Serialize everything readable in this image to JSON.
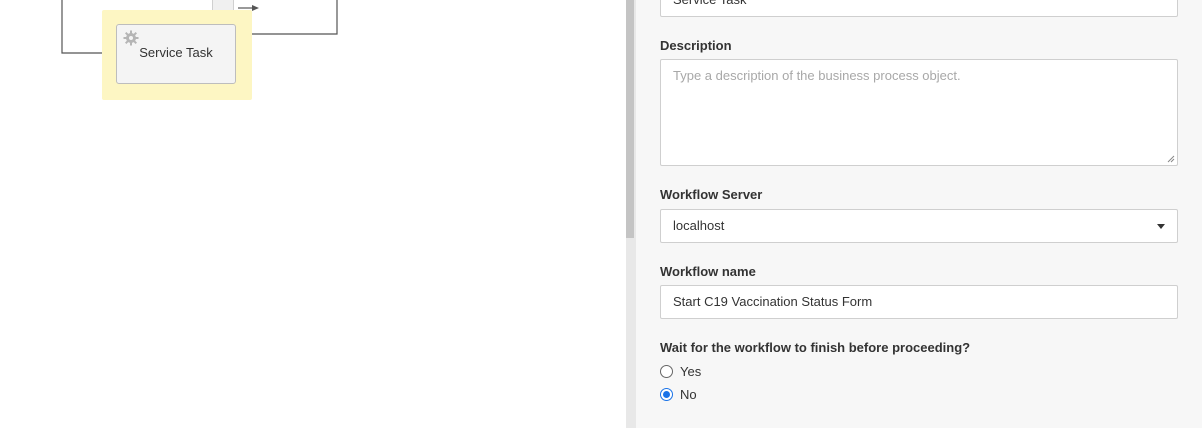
{
  "canvas": {
    "service_task": {
      "label": "Service Task",
      "icon": "gear-icon"
    }
  },
  "panel": {
    "name_field": {
      "value": "Service Task"
    },
    "description": {
      "label": "Description",
      "placeholder": "Type a description of the business process object."
    },
    "workflow_server": {
      "label": "Workflow Server",
      "value": "localhost"
    },
    "workflow_name": {
      "label": "Workflow name",
      "value": "Start C19 Vaccination Status Form"
    },
    "wait_option": {
      "label": "Wait for the workflow to finish before proceeding?",
      "options": [
        {
          "label": "Yes",
          "selected": false
        },
        {
          "label": "No",
          "selected": true
        }
      ]
    }
  },
  "colors": {
    "highlight": "#fdf6c3",
    "radio_accent": "#1a73e8"
  }
}
